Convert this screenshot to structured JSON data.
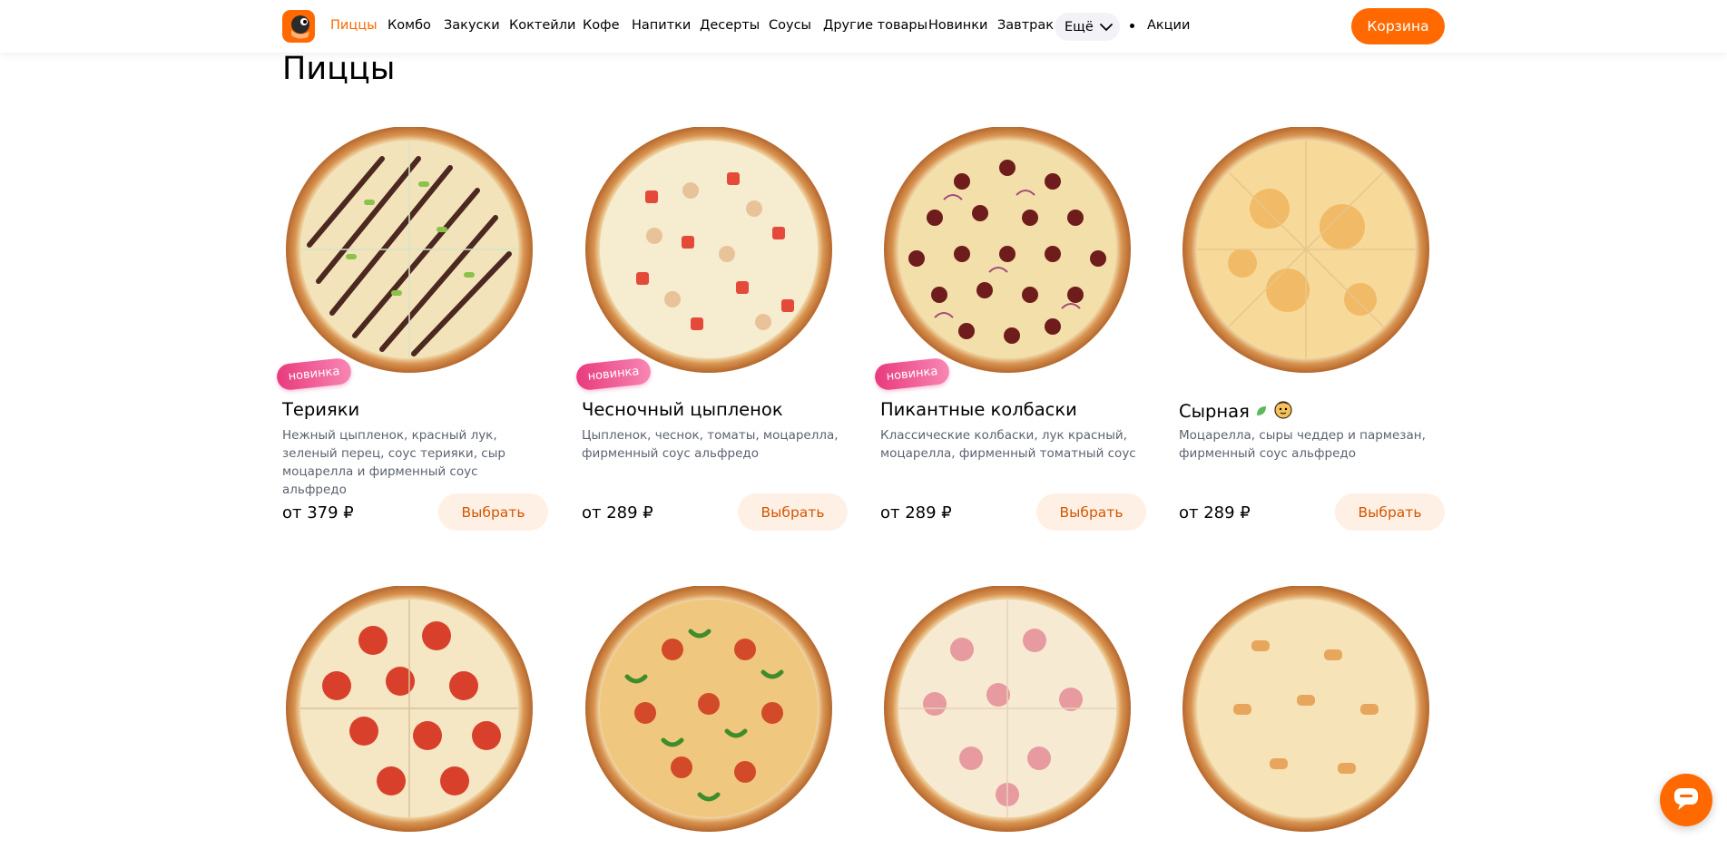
{
  "nav": {
    "items": [
      {
        "label": "Пиццы",
        "active": true
      },
      {
        "label": "Комбо"
      },
      {
        "label": "Закуски"
      },
      {
        "label": "Коктейли"
      },
      {
        "label": "Кофе"
      },
      {
        "label": "Напитки"
      },
      {
        "label": "Десерты"
      },
      {
        "label": "Соусы"
      },
      {
        "label": "Другие товары"
      },
      {
        "label": "Новинки"
      },
      {
        "label": "Завтрак"
      }
    ],
    "more_label": "Ещё",
    "promo_label": "Акции",
    "cart_label": "Корзина"
  },
  "section_title": "Пиццы",
  "choose_label": "Выбрать",
  "badge_label": "новинка",
  "products": [
    {
      "name": "Терияки",
      "new": true,
      "description": "Нежный цыпленок, красный лук, зеленый перец, соус терияки, сыр моцарелла и фирменный соус альфредо",
      "price": "от 379 ₽",
      "topping": "teriyaki"
    },
    {
      "name": "Чесночный цыпленок",
      "new": true,
      "description": "Цыпленок, чеснок, томаты, моцарелла, фирменный соус альфредо",
      "price": "от 289 ₽",
      "topping": "garlic-chicken"
    },
    {
      "name": "Пикантные колбаски",
      "new": true,
      "description": "Классические колбаски, лук красный, моцарелла, фирменный томатный соус",
      "price": "от 289 ₽",
      "topping": "sausage"
    },
    {
      "name": "Сырная",
      "new": false,
      "vegetarian_icon": "leaf-icon",
      "kids_icon": "child-face-icon",
      "description": "Моцарелла, сыры чеддер и пармезан, фирменный соус альфредо",
      "price": "от 289 ₽",
      "topping": "cheese"
    },
    {
      "topping": "pepperoni"
    },
    {
      "topping": "pepper-mix"
    },
    {
      "topping": "ham"
    },
    {
      "topping": "chicken-cheese"
    }
  ],
  "colors": {
    "accent": "#ff6900",
    "choose_bg": "#fff0e6",
    "choose_text": "#d15700",
    "badge": "#e93a7d",
    "muted_text": "#5c6370"
  }
}
